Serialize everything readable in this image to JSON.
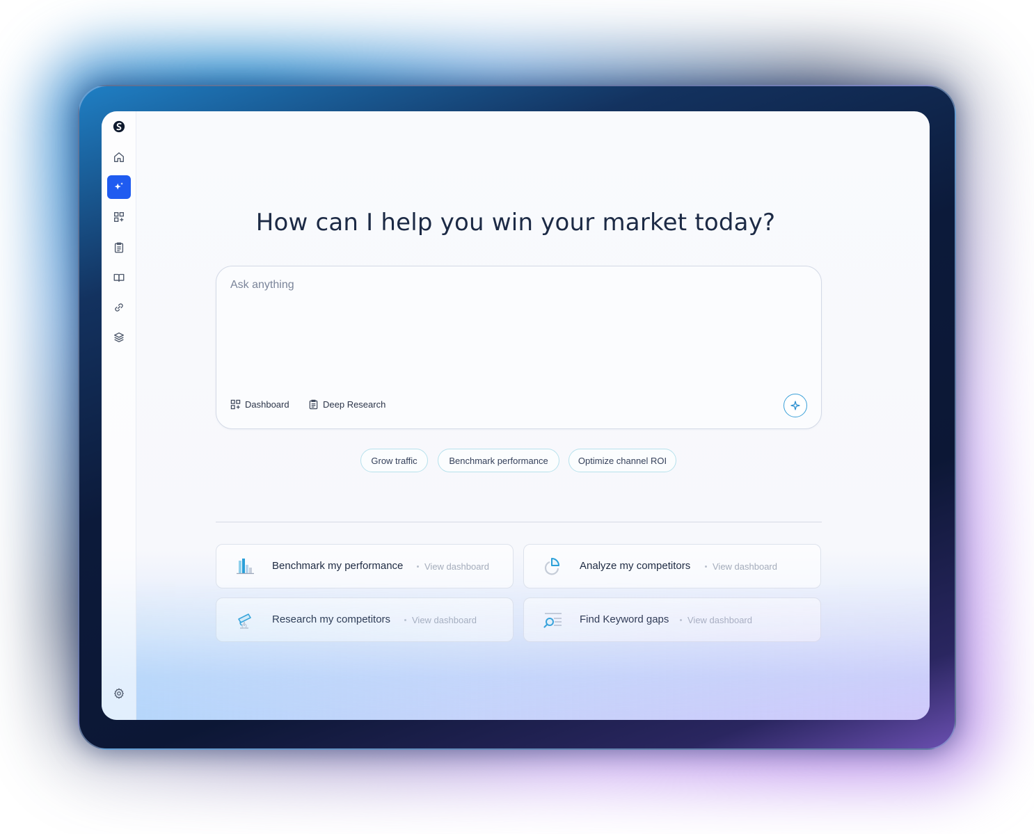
{
  "main": {
    "title": "How can I help you win your market today?",
    "ask": {
      "placeholder": "Ask anything",
      "tools": [
        {
          "label": "Dashboard",
          "icon": "dashboard-icon"
        },
        {
          "label": "Deep Research",
          "icon": "clipboard-icon"
        }
      ],
      "send_icon": "sparkle-icon"
    },
    "suggestions": [
      "Grow traffic",
      "Benchmark performance",
      "Optimize channel ROI"
    ],
    "cards": [
      {
        "title": "Benchmark my performance",
        "link": "View dashboard",
        "icon": "bar-chart-icon"
      },
      {
        "title": "Analyze my competitors",
        "link": "View dashboard",
        "icon": "pie-chart-icon"
      },
      {
        "title": "Research my competitors",
        "link": "View dashboard",
        "icon": "telescope-icon"
      },
      {
        "title": "Find Keyword gaps",
        "link": "View dashboard",
        "icon": "search-list-icon"
      }
    ]
  },
  "sidebar": {
    "items": [
      {
        "name": "logo",
        "icon": "logo-icon"
      },
      {
        "name": "home",
        "icon": "home-icon"
      },
      {
        "name": "ai-assistant",
        "icon": "sparkle-icon",
        "active": true
      },
      {
        "name": "dashboards",
        "icon": "grid-plus-icon"
      },
      {
        "name": "reports",
        "icon": "clipboard-icon"
      },
      {
        "name": "library",
        "icon": "book-icon"
      },
      {
        "name": "links",
        "icon": "link-icon"
      },
      {
        "name": "layers",
        "icon": "layers-icon"
      },
      {
        "name": "settings",
        "icon": "gear-icon"
      }
    ]
  },
  "colors": {
    "accent": "#1f5bf0",
    "chip_border": "#b7e1ec",
    "send_border": "#3aa0d8",
    "title_text": "#1c2a45"
  }
}
